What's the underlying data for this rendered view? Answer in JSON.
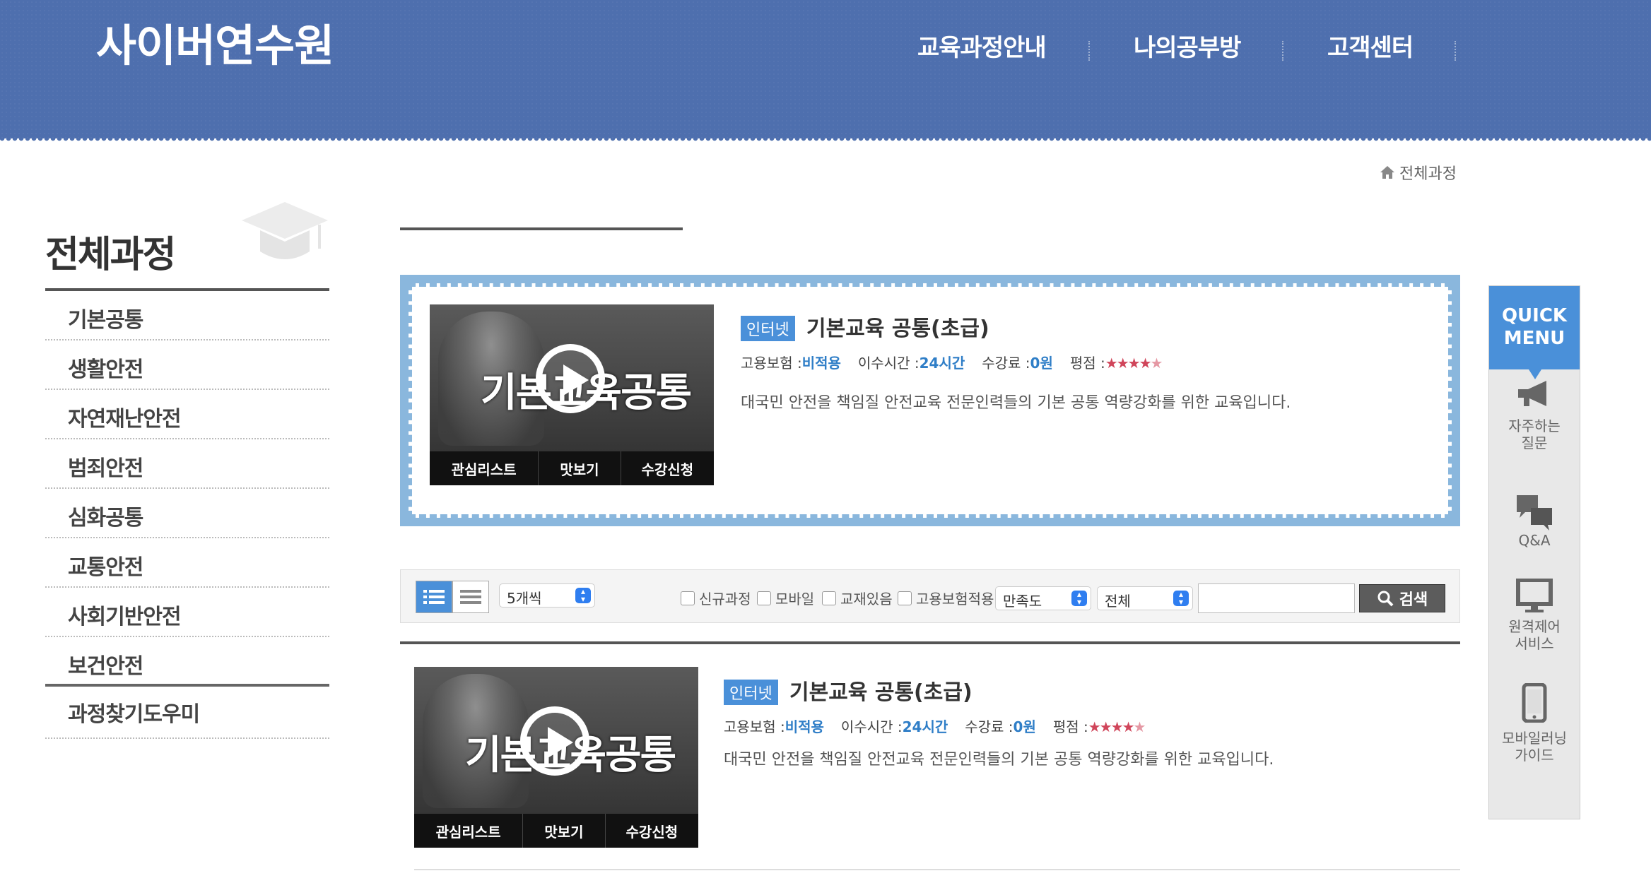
{
  "header": {
    "logo": "사이버연수원",
    "nav": [
      "교육과정안내",
      "나의공부방",
      "고객센터"
    ]
  },
  "breadcrumb": {
    "current": "전체과정"
  },
  "sidebar": {
    "title": "전체과정",
    "items": [
      "기본공통",
      "생활안전",
      "자연재난안전",
      "범죄안전",
      "심화공통",
      "교통안전",
      "사회기반안전",
      "보건안전"
    ],
    "extra": "과정찾기도우미"
  },
  "featured_course": {
    "thumb_title": "기본교육공통",
    "buttons": [
      "관심리스트",
      "맛보기",
      "수강신청"
    ],
    "tag": "인터넷",
    "title": "기본교육 공통(초급)",
    "meta": {
      "insurance_label": "고용보험 :",
      "insurance_value": "비적용",
      "hours_label": "이수시간 :",
      "hours_value": "24시간",
      "fee_label": "수강료 :",
      "fee_value": "0원",
      "rating_label": "평점 :",
      "rating": 4.5
    },
    "description": "대국민 안전을 책임질 안전교육 전문인력들의 기본 공통 역량강화를 위한 교육입니다."
  },
  "toolbar": {
    "per_page": "5개씩",
    "checkboxes": [
      "신규과정",
      "모바일",
      "교재있음",
      "고용보험적용"
    ],
    "sort": "만족도",
    "category": "전체",
    "search_value": "",
    "search_button": "검색"
  },
  "course_list": [
    {
      "thumb_title": "기본교육공통",
      "buttons": [
        "관심리스트",
        "맛보기",
        "수강신청"
      ],
      "tag": "인터넷",
      "title": "기본교육 공통(초급)",
      "meta": {
        "insurance_label": "고용보험 :",
        "insurance_value": "비적용",
        "hours_label": "이수시간 :",
        "hours_value": "24시간",
        "fee_label": "수강료 :",
        "fee_value": "0원",
        "rating_label": "평점 :",
        "rating": 4.5
      },
      "description": "대국민 안전을 책임질 안전교육 전문인력들의 기본 공통 역량강화를 위한 교육입니다."
    }
  ],
  "quick_menu": {
    "title_line1": "QUICK",
    "title_line2": "MENU",
    "items": [
      {
        "line1": "자주하는",
        "line2": "질문",
        "icon": "megaphone-icon"
      },
      {
        "line1": "Q&A",
        "line2": "",
        "icon": "chat-bubbles-icon"
      },
      {
        "line1": "원격제어",
        "line2": "서비스",
        "icon": "monitor-icon"
      },
      {
        "line1": "모바일러닝",
        "line2": "가이드",
        "icon": "smartphone-icon"
      }
    ]
  },
  "colors": {
    "header": "#4e6fae",
    "accent": "#4a90d9",
    "link": "#2f7ec7",
    "star": "#d0455a"
  }
}
